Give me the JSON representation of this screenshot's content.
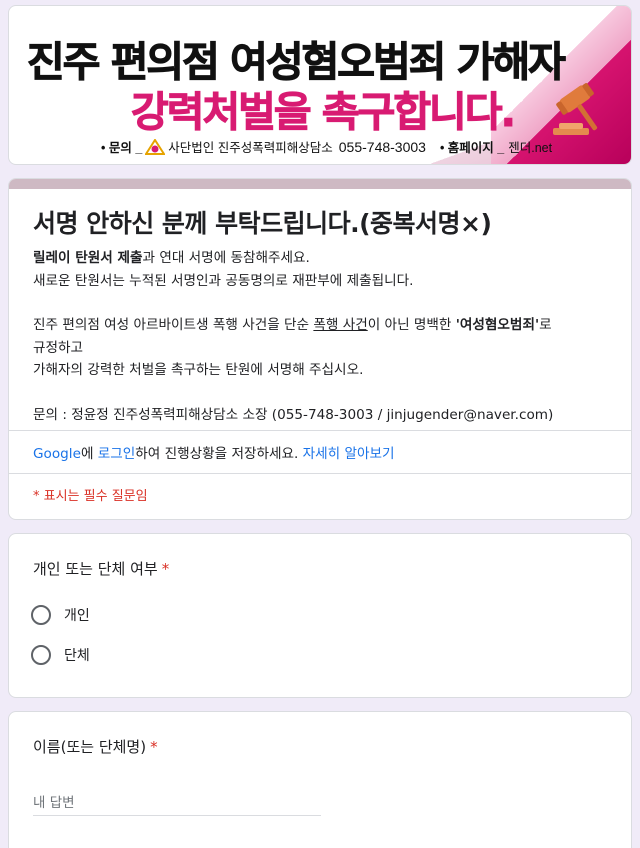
{
  "banner": {
    "line1": "진주 편의점 여성혐오범죄 가해자",
    "line2": "강력처벌을 촉구합니다.",
    "contact_prefix": "• 문의 _",
    "org_name": "사단법인 진주성폭력피해상담소",
    "phone": "055-748-3003",
    "homepage_prefix": "• 홈페이지 _",
    "homepage": "젠더.net"
  },
  "form": {
    "title": "서명 안하신 분께 부탁드립니다.(중복서명×)",
    "desc": {
      "l1_bold": "릴레이 탄원서 제출",
      "l1_rest": "과 연대 서명에 동참해주세요.",
      "l2": "새로운 탄원서는 누적된 서명인과 공동명의로 재판부에 제출됩니다.",
      "l3_a": "진주 편의점 여성 아르바이트생 폭행 사건을 단순 ",
      "l3_u": "폭행 사건",
      "l3_b": "이 아닌 명백한 ",
      "l3_bold": "'여성혐오범죄'",
      "l3_c": "로",
      "l4": "규정하고",
      "l5": "가해자의 강력한 처벌을 촉구하는 탄원에 서명해 주십시오.",
      "l6": "문의 : 정윤정 진주성폭력피해상담소 소장 (055-748-3003 / jinjugender@naver.com)"
    },
    "signin": {
      "google": "Google",
      "t1": "에 ",
      "login": "로그인",
      "t2": "하여 진행상황을 저장하세요. ",
      "learn_more": "자세히 알아보기"
    },
    "required_note": "* 표시는 필수 질문임"
  },
  "questions": [
    {
      "title": "개인 또는 단체 여부",
      "required": "*",
      "options": [
        "개인",
        "단체"
      ]
    },
    {
      "title": "이름(또는 단체명)",
      "required": "*",
      "placeholder": "내 답변"
    }
  ],
  "colors": {
    "background": "#f0ebf8",
    "banner_pink": "#d81b72",
    "required_red": "#d93025",
    "link_blue": "#1a73e8",
    "stripe": "#ceb9c3"
  }
}
